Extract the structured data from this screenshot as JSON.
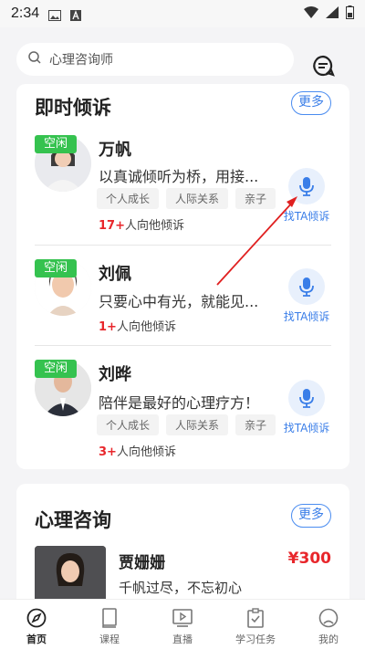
{
  "status_bar": {
    "time": "2:34"
  },
  "search": {
    "placeholder": "心理咨询师"
  },
  "instant_talk": {
    "title": "即时倾诉",
    "more_label": "更多",
    "listeners": [
      {
        "badge": "空闲",
        "name": "万帆",
        "description": "以真诚倾听为桥，用接...",
        "tags": [
          "个人成长",
          "人际关系",
          "亲子"
        ],
        "count": "17+",
        "count_suffix": "人向他倾诉",
        "button_label": "找TA倾诉"
      },
      {
        "badge": "空闲",
        "name": "刘佩",
        "description": "只要心中有光，就能见...",
        "tags": [],
        "count": "1+",
        "count_suffix": "人向他倾诉",
        "button_label": "找TA倾诉"
      },
      {
        "badge": "空闲",
        "name": "刘晔",
        "description": "陪伴是最好的心理疗方！",
        "tags": [
          "个人成长",
          "人际关系",
          "亲子"
        ],
        "count": "3+",
        "count_suffix": "人向他倾诉",
        "button_label": "找TA倾诉"
      }
    ]
  },
  "consult": {
    "title": "心理咨询",
    "more_label": "更多",
    "item": {
      "name": "贾姗姗",
      "price": "¥300",
      "description": "千帆过尽，不忘初心"
    }
  },
  "bottom_nav": {
    "items": [
      {
        "label": "首页",
        "icon": "compass-icon"
      },
      {
        "label": "课程",
        "icon": "book-icon"
      },
      {
        "label": "直播",
        "icon": "play-icon"
      },
      {
        "label": "学习任务",
        "icon": "clipboard-icon"
      },
      {
        "label": "我的",
        "icon": "profile-icon"
      }
    ],
    "active": "首页"
  },
  "colors": {
    "accent": "#3a7ee8",
    "badge": "#35c24f",
    "price": "#e8262b"
  }
}
